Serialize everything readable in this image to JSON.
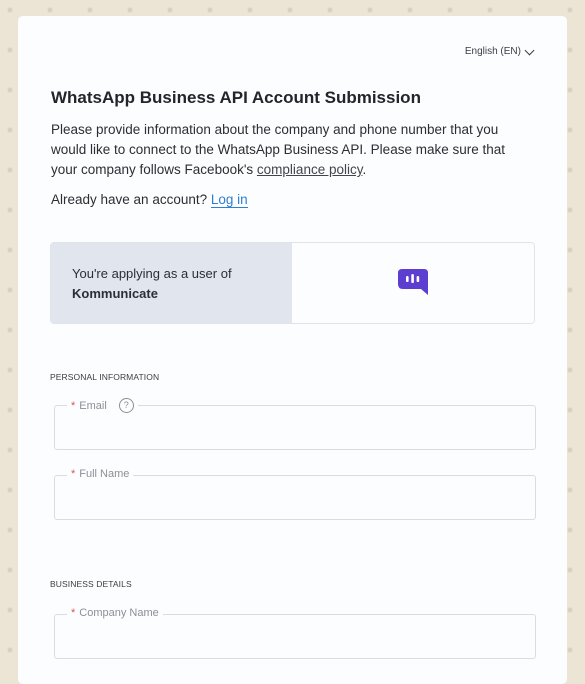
{
  "language": {
    "label": "English (EN)"
  },
  "header": {
    "title": "WhatsApp Business API Account Submission",
    "description_before_link": "Please provide information about the company and phone number that you would like to connect to the WhatsApp Business API. Please make sure that your company follows Facebook's ",
    "compliance_link": "compliance policy",
    "description_after_link": "."
  },
  "account": {
    "prompt": "Already have an account? ",
    "login_link": "Log in"
  },
  "applying": {
    "text": "You're applying as a user of",
    "partner": "Kommunicate",
    "logo_icon": "kommunicate-logo-icon",
    "logo_color": "#5c3fd1"
  },
  "personal_info": {
    "heading": "PERSONAL INFORMATION",
    "email": {
      "required_mark": "*",
      "label": "Email",
      "help_icon": "?"
    },
    "full_name": {
      "required_mark": "*",
      "label": "Full Name"
    }
  },
  "business": {
    "heading": "BUSINESS DETAILS",
    "company_name": {
      "required_mark": "*",
      "label": "Company Name"
    }
  }
}
